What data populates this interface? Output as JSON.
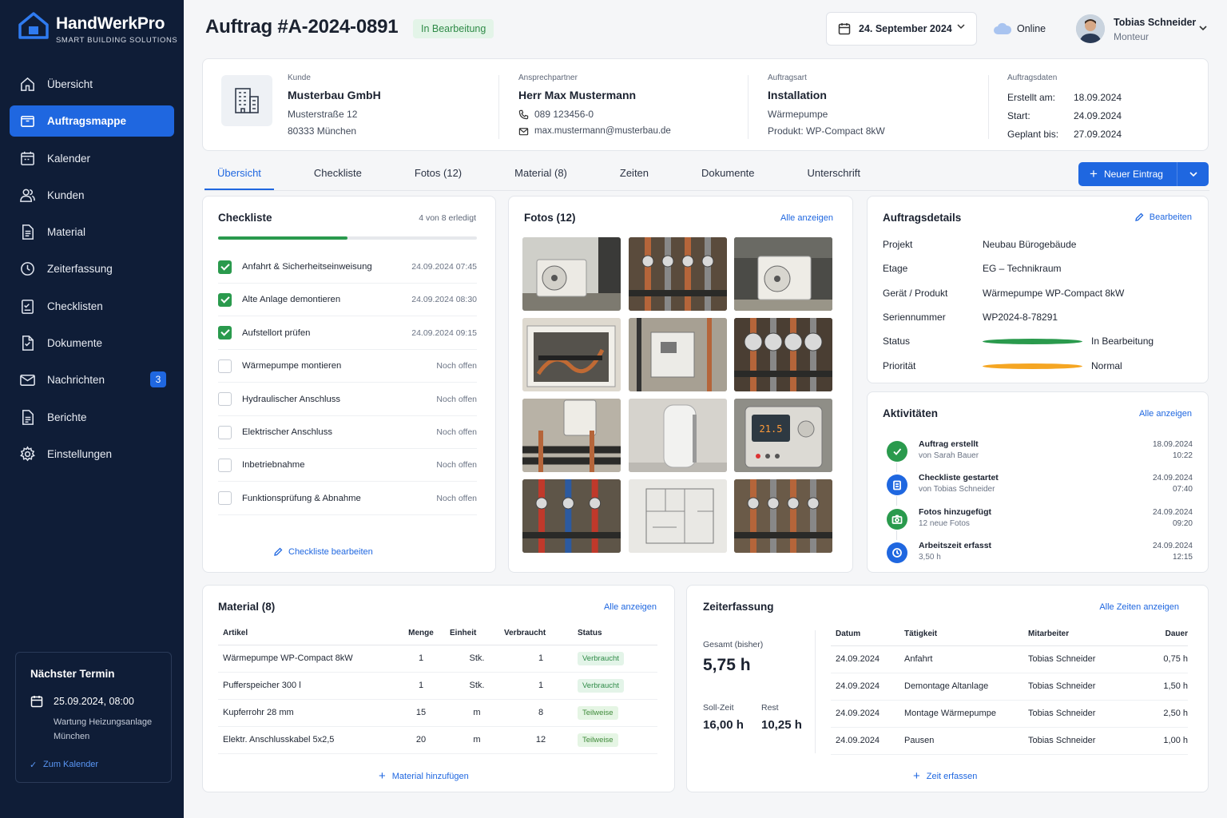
{
  "brand": {
    "name": "HandWerkPro",
    "tagline": "SMART BUILDING SOLUTIONS"
  },
  "nav": [
    {
      "label": "Übersicht",
      "icon": "home-icon"
    },
    {
      "label": "Auftragsmappe",
      "icon": "folder-icon",
      "active": true
    },
    {
      "label": "Kalender",
      "icon": "calendar-icon"
    },
    {
      "label": "Kunden",
      "icon": "users-icon"
    },
    {
      "label": "Material",
      "icon": "document-icon"
    },
    {
      "label": "Zeiterfassung",
      "icon": "clock-icon"
    },
    {
      "label": "Checklisten",
      "icon": "checklist-icon"
    },
    {
      "label": "Dokumente",
      "icon": "file-icon"
    },
    {
      "label": "Nachrichten",
      "icon": "mail-icon",
      "badge": "3"
    },
    {
      "label": "Berichte",
      "icon": "report-icon"
    },
    {
      "label": "Einstellungen",
      "icon": "gear-icon"
    }
  ],
  "next": {
    "title": "Nächster Termin",
    "date": "25.09.2024, 08:00",
    "desc": "Wartung Heizungsanlage München",
    "link": "Zum Kalender"
  },
  "header": {
    "title": "Auftrag #A-2024-0891",
    "status": "In Bearbeitung",
    "date": "24. September 2024",
    "online": "Online",
    "user": "Tobias Schneider",
    "role": "Monteur"
  },
  "info": {
    "kunde": {
      "label": "Kunde",
      "name": "Musterbau GmbH",
      "street": "Musterstraße 12",
      "city": "80333 München"
    },
    "ansprech": {
      "label": "Ansprechpartner",
      "name": "Herr Max Mustermann",
      "phone": "089 123456-0",
      "mail": "max.mustermann@musterbau.de"
    },
    "art": {
      "label": "Auftragsart",
      "name": "Installation",
      "sub": "Wärmepumpe",
      "prod": "Produkt:  WP-Compact 8kW"
    },
    "daten": {
      "label": "Auftragsdaten",
      "rows": [
        [
          "Erstellt am:",
          "18.09.2024"
        ],
        [
          "Start:",
          "24.09.2024"
        ],
        [
          "Geplant bis:",
          "27.09.2024"
        ]
      ]
    }
  },
  "tabs": [
    "Übersicht",
    "Checkliste",
    "Fotos (12)",
    "Material (8)",
    "Zeiten",
    "Dokumente",
    "Unterschrift"
  ],
  "new_button": "Neuer Eintrag",
  "checklist": {
    "title": "Checkliste",
    "count": "4 von 8 erledigt",
    "progress": 0.5,
    "edit": "Checkliste bearbeiten",
    "items": [
      {
        "t": "Anfahrt & Sicherheitseinweisung",
        "s": "24.09.2024  07:45",
        "done": true
      },
      {
        "t": "Alte Anlage demontieren",
        "s": "24.09.2024  08:30",
        "done": true
      },
      {
        "t": "Aufstellort prüfen",
        "s": "24.09.2024  09:15",
        "done": true
      },
      {
        "t": "Wärmepumpe montieren",
        "s": "Noch offen",
        "done": false
      },
      {
        "t": "Hydraulischer Anschluss",
        "s": "Noch offen",
        "done": false
      },
      {
        "t": "Elektrischer Anschluss",
        "s": "Noch offen",
        "done": false
      },
      {
        "t": "Inbetriebnahme",
        "s": "Noch offen",
        "done": false
      },
      {
        "t": "Funktionsprüfung & Abnahme",
        "s": "Noch offen",
        "done": false
      }
    ]
  },
  "photos": {
    "title": "Fotos (12)",
    "link": "Alle anzeigen",
    "thermostat": "21.5"
  },
  "details": {
    "title": "Auftragsdetails",
    "edit": "Bearbeiten",
    "rows": [
      [
        "Projekt",
        "Neubau Bürogebäude"
      ],
      [
        "Etage",
        "EG – Technikraum"
      ],
      [
        "Gerät / Produkt",
        "Wärmepumpe WP-Compact 8kW"
      ],
      [
        "Seriennummer",
        "WP2024-8-78291"
      ],
      [
        "Status",
        "In Bearbeitung"
      ],
      [
        "Priorität",
        "Normal"
      ]
    ],
    "status_color": "#2a9a4d",
    "prio_color": "#f5a623"
  },
  "activities": {
    "title": "Aktivitäten",
    "link": "Alle anzeigen",
    "items": [
      {
        "t": "Auftrag erstellt",
        "s": "von Sarah Bauer",
        "d": "18.09.2024",
        "h": "10:22",
        "color": "#2a9a4d",
        "icon": "check-icon"
      },
      {
        "t": "Checkliste gestartet",
        "s": "von Tobias Schneider",
        "d": "24.09.2024",
        "h": "07:40",
        "color": "#1f67e0",
        "icon": "clipboard-icon"
      },
      {
        "t": "Fotos hinzugefügt",
        "s": "12 neue Fotos",
        "d": "24.09.2024",
        "h": "09:20",
        "color": "#2a9a4d",
        "icon": "camera-icon"
      },
      {
        "t": "Arbeitszeit erfasst",
        "s": "3,50 h",
        "d": "24.09.2024",
        "h": "12:15",
        "color": "#1f67e0",
        "icon": "clock-icon"
      }
    ]
  },
  "material": {
    "title": "Material (8)",
    "link": "Alle anzeigen",
    "add": "Material hinzufügen",
    "headers": [
      "Artikel",
      "Menge",
      "Einheit",
      "Verbraucht",
      "Status"
    ],
    "rows": [
      [
        "Wärmepumpe WP-Compact 8kW",
        "1",
        "Stk.",
        "1",
        "Verbraucht"
      ],
      [
        "Pufferspeicher 300 l",
        "1",
        "Stk.",
        "1",
        "Verbraucht"
      ],
      [
        "Kupferrohr 28 mm",
        "15",
        "m",
        "8",
        "Teilweise"
      ],
      [
        "Elektr. Anschlusskabel 5x2,5",
        "20",
        "m",
        "12",
        "Teilweise"
      ]
    ]
  },
  "zeit": {
    "title": "Zeiterfassung",
    "link": "Alle Zeiten anzeigen",
    "add": "Zeit erfassen",
    "total_label": "Gesamt (bisher)",
    "total": "5,75 h",
    "soll_label": "Soll-Zeit",
    "soll": "16,00 h",
    "rest_label": "Rest",
    "rest": "10,25 h",
    "headers": [
      "Datum",
      "Tätigkeit",
      "Mitarbeiter",
      "Dauer"
    ],
    "rows": [
      [
        "24.09.2024",
        "Anfahrt",
        "Tobias Schneider",
        "0,75 h"
      ],
      [
        "24.09.2024",
        "Demontage Altanlage",
        "Tobias Schneider",
        "1,50 h"
      ],
      [
        "24.09.2024",
        "Montage Wärmepumpe",
        "Tobias Schneider",
        "2,50 h"
      ],
      [
        "24.09.2024",
        "Pausen",
        "Tobias Schneider",
        "1,00 h"
      ]
    ]
  }
}
